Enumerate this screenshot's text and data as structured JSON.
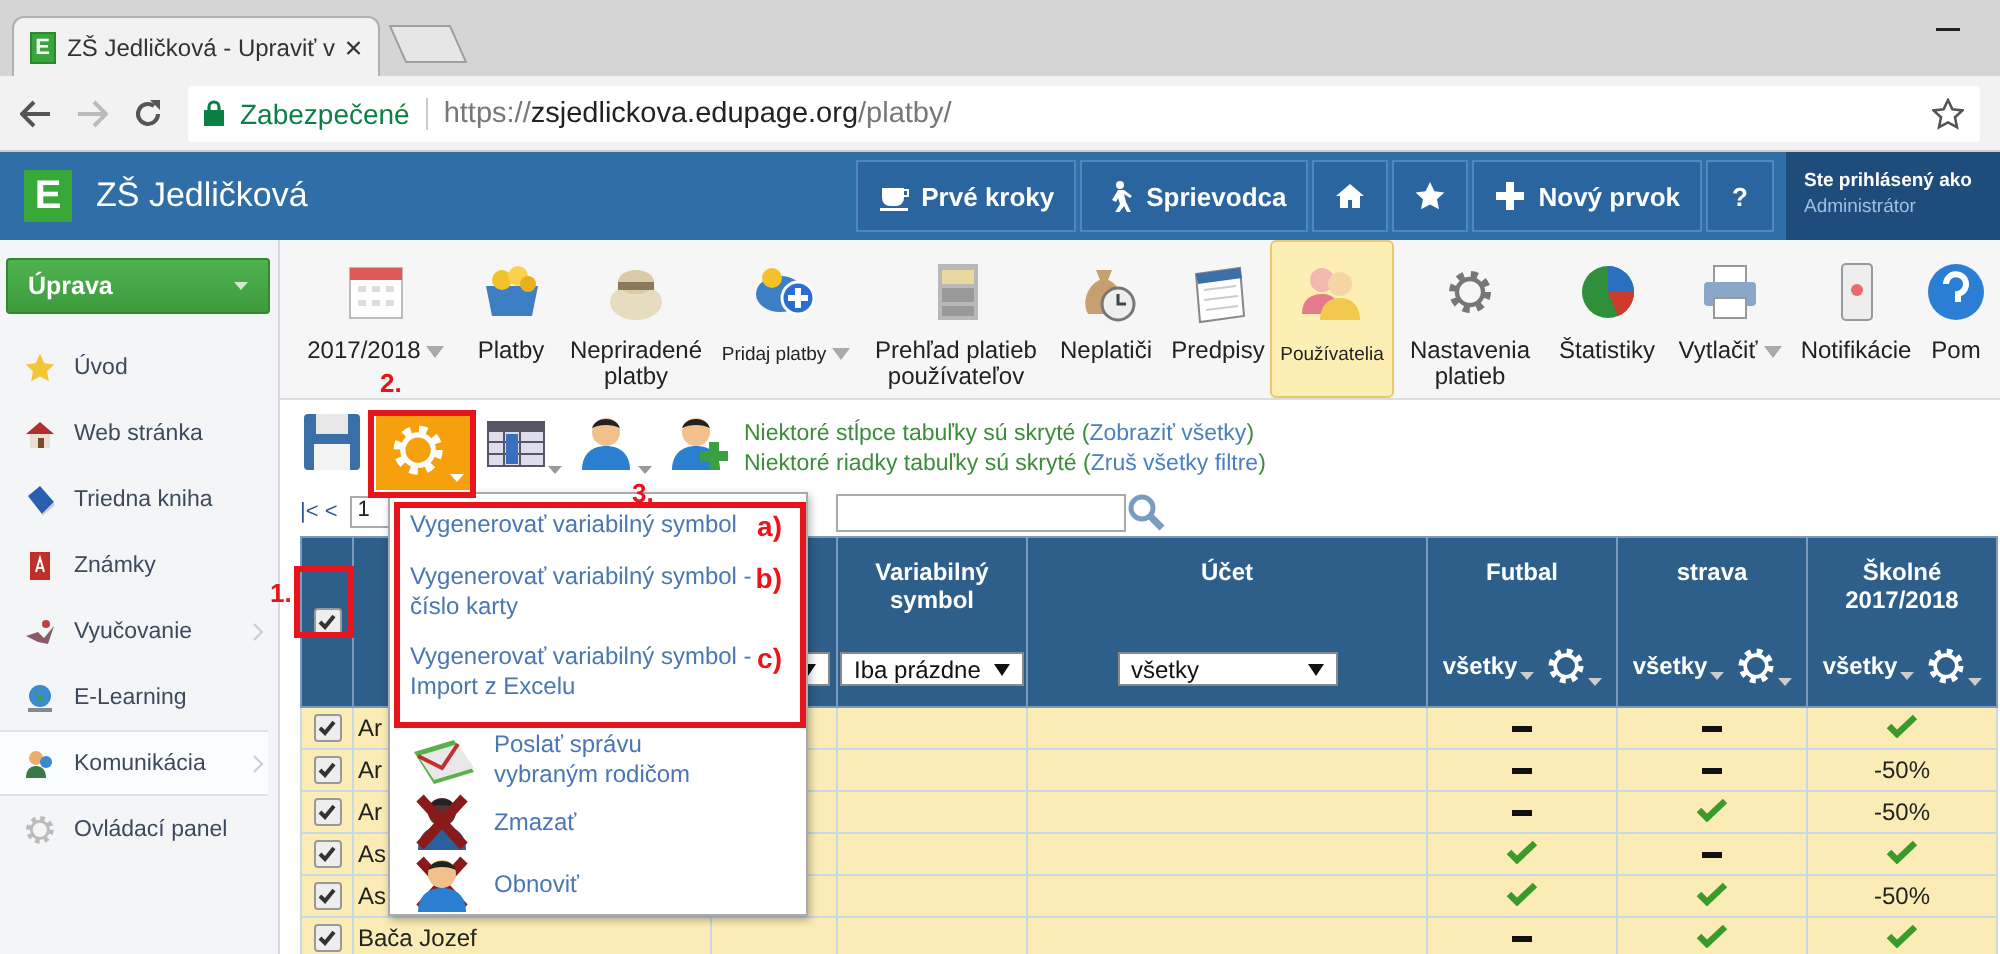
{
  "browser": {
    "favicon_letter": "E",
    "tab_title": "ZŠ Jedličková - Upraviť v",
    "secure_label": "Zabezpečené",
    "url": {
      "scheme": "https://",
      "host": "zsjedlickova.edupage.org",
      "path": "/platby/"
    }
  },
  "header": {
    "logo_letter": "E",
    "title": "ZŠ Jedličková",
    "buttons": [
      {
        "kind": "label",
        "label": "Prvé kroky"
      },
      {
        "kind": "label",
        "label": "Sprievodca"
      },
      {
        "kind": "icon"
      },
      {
        "kind": "icon"
      },
      {
        "kind": "label",
        "label": "Nový prvok"
      },
      {
        "kind": "label",
        "label": "?"
      }
    ],
    "user": {
      "caption": "Ste prihlásený ako",
      "name": "Administrátor"
    }
  },
  "sidebar": {
    "menu_button": "Úprava",
    "items": [
      {
        "label": "Úvod",
        "selected": false,
        "has_submenu": false
      },
      {
        "label": "Web stránka",
        "selected": false,
        "has_submenu": false
      },
      {
        "label": "Triedna kniha",
        "selected": false,
        "has_submenu": false
      },
      {
        "label": "Známky",
        "selected": false,
        "has_submenu": false
      },
      {
        "label": "Vyučovanie",
        "selected": false,
        "has_submenu": true
      },
      {
        "label": "E-Learning",
        "selected": false,
        "has_submenu": false
      },
      {
        "label": "Komunikácia",
        "selected": true,
        "has_submenu": true
      },
      {
        "label": "Ovládací panel",
        "selected": false,
        "has_submenu": false
      }
    ]
  },
  "toolbar": {
    "items": [
      {
        "label": "2017/2018",
        "selected": false,
        "dropdown": true,
        "compact": false
      },
      {
        "label": "Platby",
        "selected": false,
        "dropdown": false,
        "compact": false
      },
      {
        "label": "Nepriradené platby",
        "selected": false,
        "dropdown": false,
        "compact": false
      },
      {
        "label": "Pridaj platby",
        "selected": false,
        "dropdown": true,
        "compact": true
      },
      {
        "label": "Prehľad platieb používateľov",
        "selected": false,
        "dropdown": false,
        "compact": false
      },
      {
        "label": "Neplatiči",
        "selected": false,
        "dropdown": false,
        "compact": false
      },
      {
        "label": "Predpisy",
        "selected": false,
        "dropdown": false,
        "compact": false
      },
      {
        "label": "Používatelia",
        "selected": true,
        "dropdown": false,
        "compact": true
      },
      {
        "label": "Nastavenia platieb",
        "selected": false,
        "dropdown": false,
        "compact": false
      },
      {
        "label": "Štatistiky",
        "selected": false,
        "dropdown": false,
        "compact": false
      },
      {
        "label": "Vytlačiť",
        "selected": false,
        "dropdown": true,
        "compact": false
      },
      {
        "label": "Notifikácie",
        "selected": false,
        "dropdown": false,
        "compact": false
      },
      {
        "label": "Pom",
        "selected": false,
        "dropdown": false,
        "compact": false
      }
    ]
  },
  "actions": {
    "buttons": [
      {
        "selected": false,
        "dropdown": false
      },
      {
        "selected": true,
        "dropdown": true
      },
      {
        "selected": false,
        "dropdown": true
      },
      {
        "selected": false,
        "dropdown": true
      },
      {
        "selected": false,
        "dropdown": false
      }
    ],
    "notices": [
      {
        "text": "Niektoré stĺpce tabuľky sú skryté (",
        "link": "Zobraziť všetky",
        "end": ")"
      },
      {
        "text": "Niektoré riadky tabuľky sú skryté (",
        "link": "Zruš všetky filtre",
        "end": ")"
      }
    ]
  },
  "pager": {
    "first_prev": "|< <",
    "page": "1"
  },
  "table": {
    "header_checked": true,
    "columns": [
      {
        "title": "Variabilný symbol",
        "filter": "Iba prázdne",
        "kind": "select"
      },
      {
        "title": "Účet",
        "filter": "všetky",
        "kind": "select"
      },
      {
        "title": "Futbal",
        "filter": "všetky",
        "kind": "toggle"
      },
      {
        "title": "strava",
        "filter": "všetky",
        "kind": "toggle"
      },
      {
        "title": "Školné 2017/2018",
        "filter": "všetky",
        "kind": "toggle"
      }
    ],
    "rows": [
      {
        "checked": true,
        "name": "Ar",
        "cells": [
          {
            "kind": "dash"
          },
          {
            "kind": "dash"
          },
          {
            "kind": "check"
          }
        ]
      },
      {
        "checked": true,
        "name": "Ar",
        "cells": [
          {
            "kind": "dash"
          },
          {
            "kind": "dash"
          },
          {
            "kind": "text",
            "text": "-50%"
          }
        ]
      },
      {
        "checked": true,
        "name": "Ar",
        "cells": [
          {
            "kind": "dash"
          },
          {
            "kind": "check"
          },
          {
            "kind": "text",
            "text": "-50%"
          }
        ]
      },
      {
        "checked": true,
        "name": "As",
        "cells": [
          {
            "kind": "check"
          },
          {
            "kind": "dash"
          },
          {
            "kind": "check"
          }
        ]
      },
      {
        "checked": true,
        "name": "As",
        "cells": [
          {
            "kind": "check"
          },
          {
            "kind": "check"
          },
          {
            "kind": "text",
            "text": "-50%"
          }
        ]
      },
      {
        "checked": true,
        "name": "Bača Jozef",
        "cells": [
          {
            "kind": "dash"
          },
          {
            "kind": "check"
          },
          {
            "kind": "check"
          }
        ]
      }
    ]
  },
  "menu": {
    "items": [
      {
        "kind": "text",
        "label": "Vygenerovať variabilný symbol",
        "marker": "a)"
      },
      {
        "kind": "text",
        "label": "Vygenerovať variabilný symbol - číslo karty",
        "marker": "b)"
      },
      {
        "kind": "text",
        "label": "Vygenerovať variabilný symbol - Import z Excelu",
        "marker": "c)"
      },
      {
        "kind": "icon",
        "label": "Poslať správu vybraným rodičom"
      },
      {
        "kind": "icon",
        "label": "Zmazať"
      },
      {
        "kind": "icon",
        "label": "Obnoviť"
      }
    ]
  },
  "annotations": [
    "1.",
    "2.",
    "3."
  ]
}
